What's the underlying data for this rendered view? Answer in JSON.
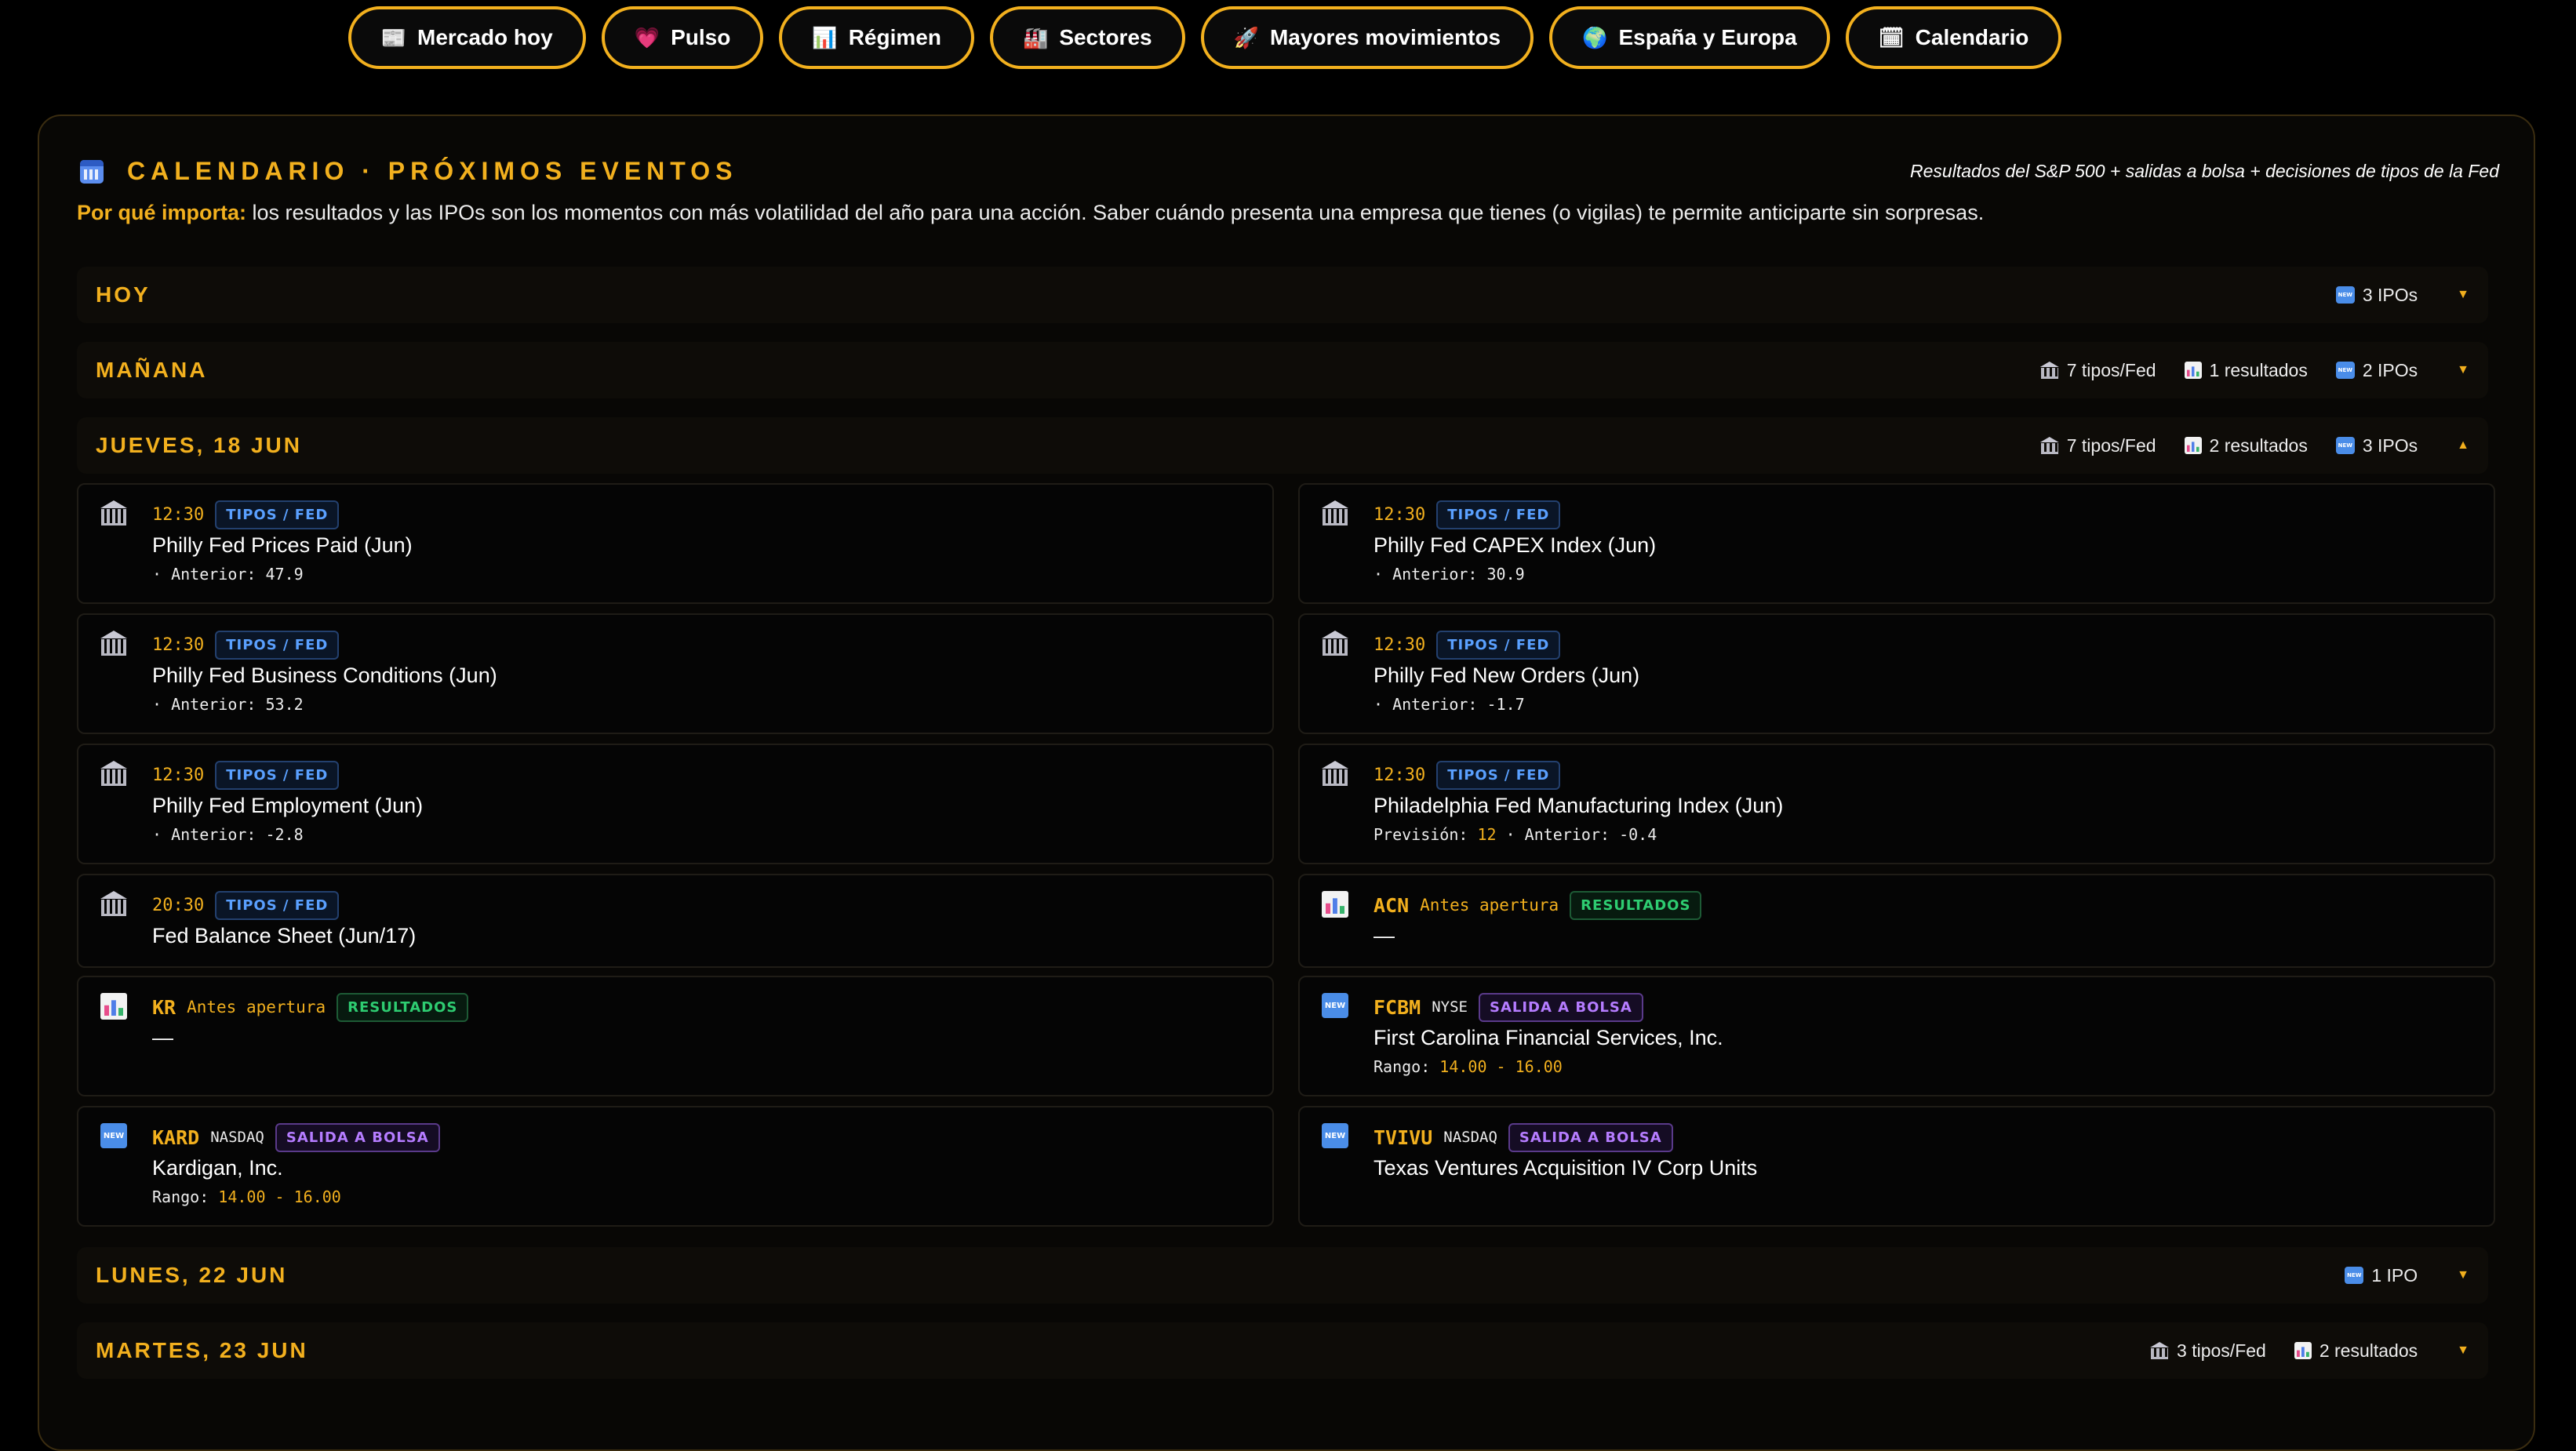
{
  "nav": [
    {
      "icon": "📰",
      "label": "Mercado hoy"
    },
    {
      "icon": "💗",
      "label": "Pulso"
    },
    {
      "icon": "📊",
      "label": "Régimen"
    },
    {
      "icon": "🏭",
      "label": "Sectores"
    },
    {
      "icon": "🚀",
      "label": "Mayores movimientos"
    },
    {
      "icon": "🌍",
      "label": "España y Europa"
    },
    {
      "icon": "🗓",
      "label": "Calendario"
    }
  ],
  "header": {
    "title": "CALENDARIO · PRÓXIMOS EVENTOS",
    "subtitle": "Resultados del S&P 500 + salidas a bolsa + decisiones de tipos de la Fed",
    "why_lead": "Por qué importa:",
    "why_text": " los resultados y las IPOs son los momentos con más volatilidad del año para una acción. Saber cuándo presenta una empresa que tienes (o vigilas) te permite anticiparte sin sorpresas."
  },
  "days": [
    {
      "name": "HOY",
      "fed": "",
      "results": "",
      "ipos": "3 IPOs",
      "caret": "▼"
    },
    {
      "name": "MAÑANA",
      "fed": "7 tipos/Fed",
      "results": "1 resultados",
      "ipos": "2 IPOs",
      "caret": "▼"
    },
    {
      "name": "JUEVES, 18 JUN",
      "fed": "7 tipos/Fed",
      "results": "2 resultados",
      "ipos": "3 IPOs",
      "caret": "▲"
    },
    {
      "name": "LUNES, 22 JUN",
      "fed": "",
      "results": "",
      "ipos": "1 IPO",
      "caret": "▼"
    },
    {
      "name": "MARTES, 23 JUN",
      "fed": "3 tipos/Fed",
      "results": "2 resultados",
      "ipos": "",
      "caret": "▼"
    }
  ],
  "events": [
    {
      "kind": "fed",
      "time": "12:30",
      "badge": "TIPOS / FED",
      "title": "Philly Fed Prices Paid (Jun)",
      "detail_a": "· Anterior: 47.9"
    },
    {
      "kind": "fed",
      "time": "12:30",
      "badge": "TIPOS / FED",
      "title": "Philly Fed CAPEX Index (Jun)",
      "detail_a": "· Anterior: 30.9"
    },
    {
      "kind": "fed",
      "time": "12:30",
      "badge": "TIPOS / FED",
      "title": "Philly Fed Business Conditions (Jun)",
      "detail_a": "· Anterior: 53.2"
    },
    {
      "kind": "fed",
      "time": "12:30",
      "badge": "TIPOS / FED",
      "title": "Philly Fed New Orders (Jun)",
      "detail_a": "· Anterior: -1.7"
    },
    {
      "kind": "fed",
      "time": "12:30",
      "badge": "TIPOS / FED",
      "title": "Philly Fed Employment (Jun)",
      "detail_a": "· Anterior: -2.8"
    },
    {
      "kind": "fed",
      "time": "12:30",
      "badge": "TIPOS / FED",
      "title": "Philadelphia Fed Manufacturing Index (Jun)",
      "detail_a": "Previsión: ",
      "detail_hl": "12",
      "detail_b": " · Anterior: -0.4"
    },
    {
      "kind": "fed",
      "time": "20:30",
      "badge": "TIPOS / FED",
      "title": "Fed Balance Sheet (Jun/17)"
    },
    {
      "kind": "res",
      "ticker": "ACN",
      "when": "Antes apertura",
      "badge": "RESULTADOS",
      "title": "—"
    },
    {
      "kind": "res",
      "ticker": "KR",
      "when": "Antes apertura",
      "badge": "RESULTADOS",
      "title": "—"
    },
    {
      "kind": "ipo",
      "ticker": "FCBM",
      "exchange": "NYSE",
      "badge": "SALIDA A BOLSA",
      "title": "First Carolina Financial Services, Inc.",
      "detail_a": "Rango: ",
      "detail_hl": "14.00 - 16.00"
    },
    {
      "kind": "ipo",
      "ticker": "KARD",
      "exchange": "NASDAQ",
      "badge": "SALIDA A BOLSA",
      "title": "Kardigan, Inc.",
      "detail_a": "Rango: ",
      "detail_hl": "14.00 - 16.00"
    },
    {
      "kind": "ipo",
      "ticker": "TVIVU",
      "exchange": "NASDAQ",
      "badge": "SALIDA A BOLSA",
      "title": "Texas Ventures Acquisition IV Corp Units"
    }
  ],
  "icons": {
    "fed": "bank-icon",
    "res": "bar-chart-icon",
    "ipo": "new-icon",
    "new_label": "NEW"
  },
  "colors": {
    "accent": "#f2b01e",
    "fed": "#5aa0ff",
    "results": "#2ecc71",
    "ipo": "#b57cff",
    "background": "#000000"
  }
}
